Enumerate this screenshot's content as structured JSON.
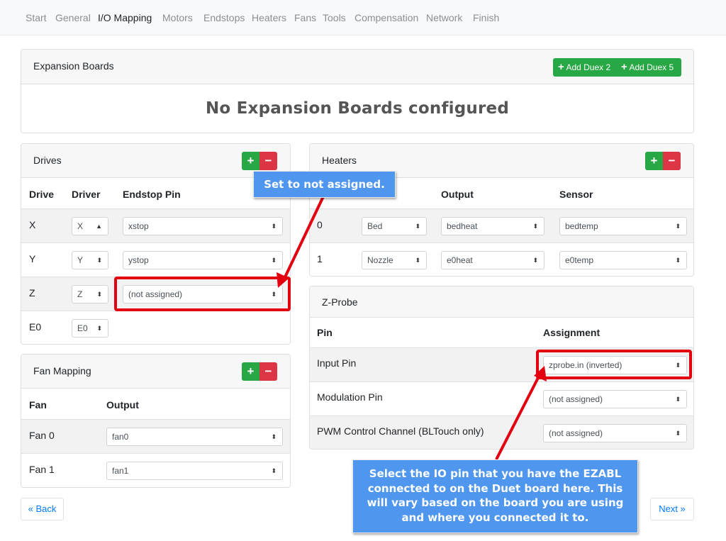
{
  "nav": {
    "items": [
      "Start",
      "General",
      "I/O Mapping",
      "Motors",
      "Endstops",
      "Heaters",
      "Fans",
      "Tools",
      "Compensation",
      "Network",
      "Finish"
    ],
    "active": "I/O Mapping"
  },
  "expansion": {
    "title": "Expansion Boards",
    "add_duex2": "Add Duex 2",
    "add_duex5": "Add Duex 5",
    "empty_message": "No Expansion Boards configured"
  },
  "drives": {
    "title": "Drives",
    "headers": [
      "Drive",
      "Driver",
      "Endstop Pin"
    ],
    "rows": [
      {
        "drive": "X",
        "driver": "X",
        "endstop": "xstop"
      },
      {
        "drive": "Y",
        "driver": "Y",
        "endstop": "ystop"
      },
      {
        "drive": "Z",
        "driver": "Z",
        "endstop": "(not assigned)"
      },
      {
        "drive": "E0",
        "driver": "E0",
        "endstop": ""
      }
    ]
  },
  "fan_mapping": {
    "title": "Fan Mapping",
    "headers": [
      "Fan",
      "Output"
    ],
    "rows": [
      {
        "fan": "Fan 0",
        "output": "fan0"
      },
      {
        "fan": "Fan 1",
        "output": "fan1"
      }
    ]
  },
  "heaters": {
    "title": "Heaters",
    "headers": [
      "Output",
      "Sensor"
    ],
    "rows": [
      {
        "index": "0",
        "type": "Bed",
        "output": "bedheat",
        "sensor": "bedtemp"
      },
      {
        "index": "1",
        "type": "Nozzle",
        "output": "e0heat",
        "sensor": "e0temp"
      }
    ]
  },
  "zprobe": {
    "title": "Z-Probe",
    "headers": [
      "Pin",
      "Assignment"
    ],
    "rows": [
      {
        "pin": "Input Pin",
        "assignment": "zprobe.in (inverted)"
      },
      {
        "pin": "Modulation Pin",
        "assignment": "(not assigned)"
      },
      {
        "pin": "PWM Control Channel (BLTouch only)",
        "assignment": "(not assigned)"
      }
    ]
  },
  "buttons": {
    "back": "« Back",
    "next": "Next »",
    "plus": "+",
    "minus": "−"
  },
  "annotations": {
    "endstop_callout": "Set to not assigned.",
    "probe_callout": "Select the IO pin that you have the EZABL connected to on the Duet board here. This will vary based on the board you are using and where you connected it to."
  },
  "colors": {
    "accent_green": "#28a745",
    "danger_red": "#dc3545",
    "highlight_red": "#e3000f",
    "callout_blue": "#4f96ee",
    "link_blue": "#007bff"
  }
}
